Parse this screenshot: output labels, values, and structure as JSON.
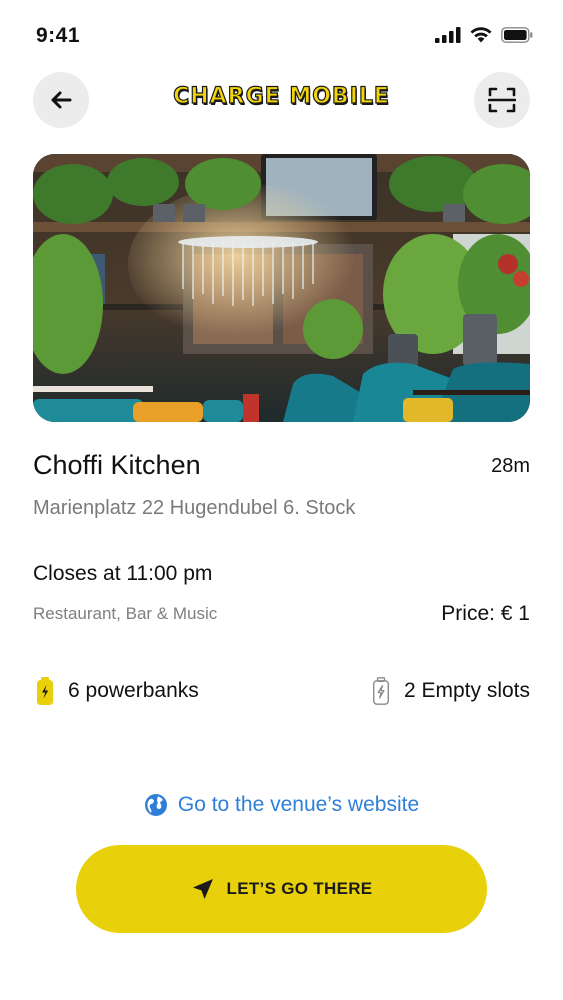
{
  "status_bar": {
    "time": "9:41"
  },
  "header": {
    "title": "CHARGE MOBILE"
  },
  "venue": {
    "name": "Choffi Kitchen",
    "distance": "28m",
    "address": "Marienplatz 22 Hugendubel 6. Stock",
    "hours": "Closes at 11:00 pm",
    "category": "Restaurant, Bar & Music",
    "price": "Price: € 1"
  },
  "stats": {
    "powerbanks": "6 powerbanks",
    "empty_slots": "2 Empty slots"
  },
  "website_link": {
    "label": "Go to the venue’s website"
  },
  "cta": {
    "label": "LET’S GO THERE"
  },
  "colors": {
    "accent": "#e8d00a",
    "link": "#2f7fd8",
    "icon_button_bg": "#ececec"
  },
  "icons": [
    "back-arrow-icon",
    "scan-icon",
    "powerbank-icon",
    "empty-slot-icon",
    "globe-icon",
    "navigation-arrow-icon"
  ]
}
